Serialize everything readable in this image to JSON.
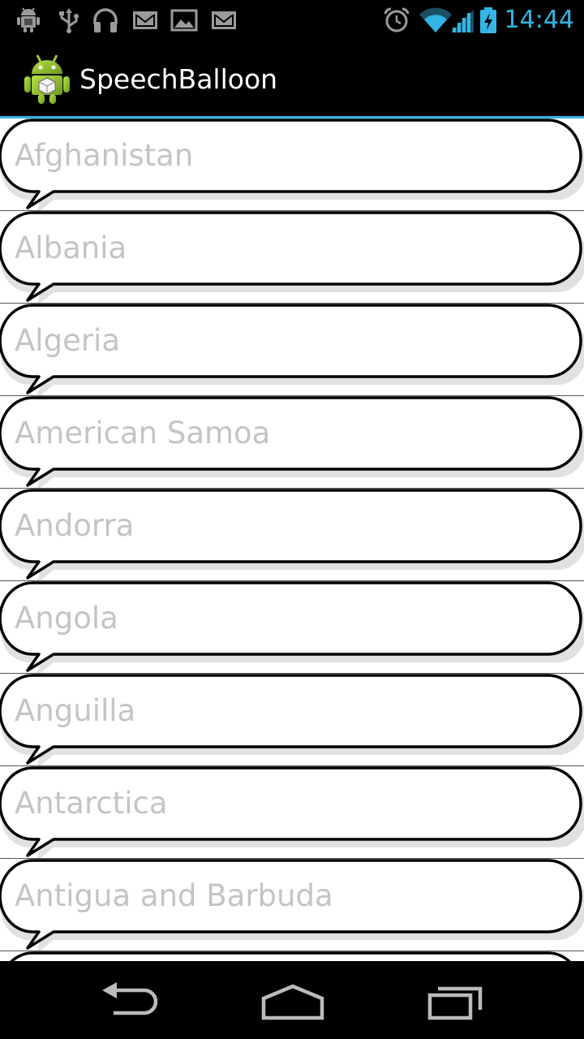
{
  "status_bar": {
    "time": "14:44",
    "left_icons": [
      "android-debug-icon",
      "usb-icon",
      "headset-icon",
      "gmail-icon",
      "gallery-icon",
      "gmail-icon"
    ],
    "right_icons": [
      "alarm-icon",
      "wifi-icon",
      "signal-icon",
      "battery-charging-icon"
    ]
  },
  "action_bar": {
    "title": "SpeechBalloon",
    "icon": "android-robot-icon"
  },
  "list": {
    "items": [
      "Afghanistan",
      "Albania",
      "Algeria",
      "American Samoa",
      "Andorra",
      "Angola",
      "Anguilla",
      "Antarctica",
      "Antigua and Barbuda"
    ]
  },
  "nav_bar": {
    "buttons": [
      "back-icon",
      "home-icon",
      "recent-apps-icon"
    ]
  },
  "colors": {
    "accent": "#33b5e5",
    "item_text": "#c4c4c4",
    "background": "#000000"
  }
}
